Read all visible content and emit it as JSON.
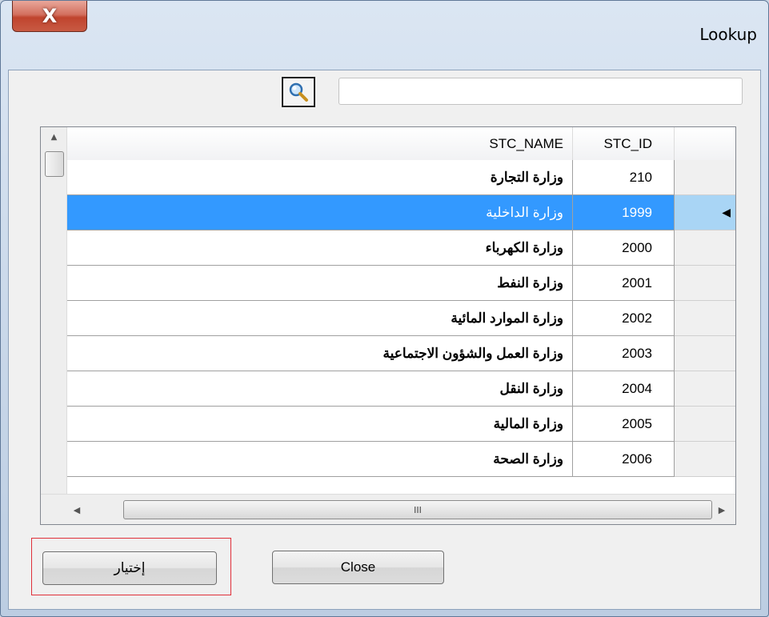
{
  "window": {
    "title": "Lookup",
    "close_glyph": "X"
  },
  "search": {
    "icon": "search-icon",
    "value": "",
    "placeholder": ""
  },
  "grid": {
    "columns": [
      {
        "key": "name",
        "label": "STC_NAME"
      },
      {
        "key": "id",
        "label": "STC_ID"
      }
    ],
    "rows": [
      {
        "name": "وزارة التجارة",
        "id": "210",
        "selected": false
      },
      {
        "name": "وزارة الداخلية",
        "id": "1999",
        "selected": true
      },
      {
        "name": "وزارة الكهرباء",
        "id": "2000",
        "selected": false
      },
      {
        "name": "وزارة النفط",
        "id": "2001",
        "selected": false
      },
      {
        "name": "وزارة الموارد المائية",
        "id": "2002",
        "selected": false
      },
      {
        "name": "وزارة العمل والشؤون الاجتماعية",
        "id": "2003",
        "selected": false
      },
      {
        "name": "وزارة النقل",
        "id": "2004",
        "selected": false
      },
      {
        "name": "وزارة المالية",
        "id": "2005",
        "selected": false
      },
      {
        "name": "وزارة الصحة",
        "id": "2006",
        "selected": false
      }
    ],
    "current_row_indicator": "◀",
    "hscroll_grip": "III"
  },
  "buttons": {
    "choose_label": "إختيار",
    "close_label": "Close"
  },
  "colors": {
    "selection": "#3399ff",
    "highlight_border": "#e0303a",
    "close_button": "#c0442e"
  }
}
